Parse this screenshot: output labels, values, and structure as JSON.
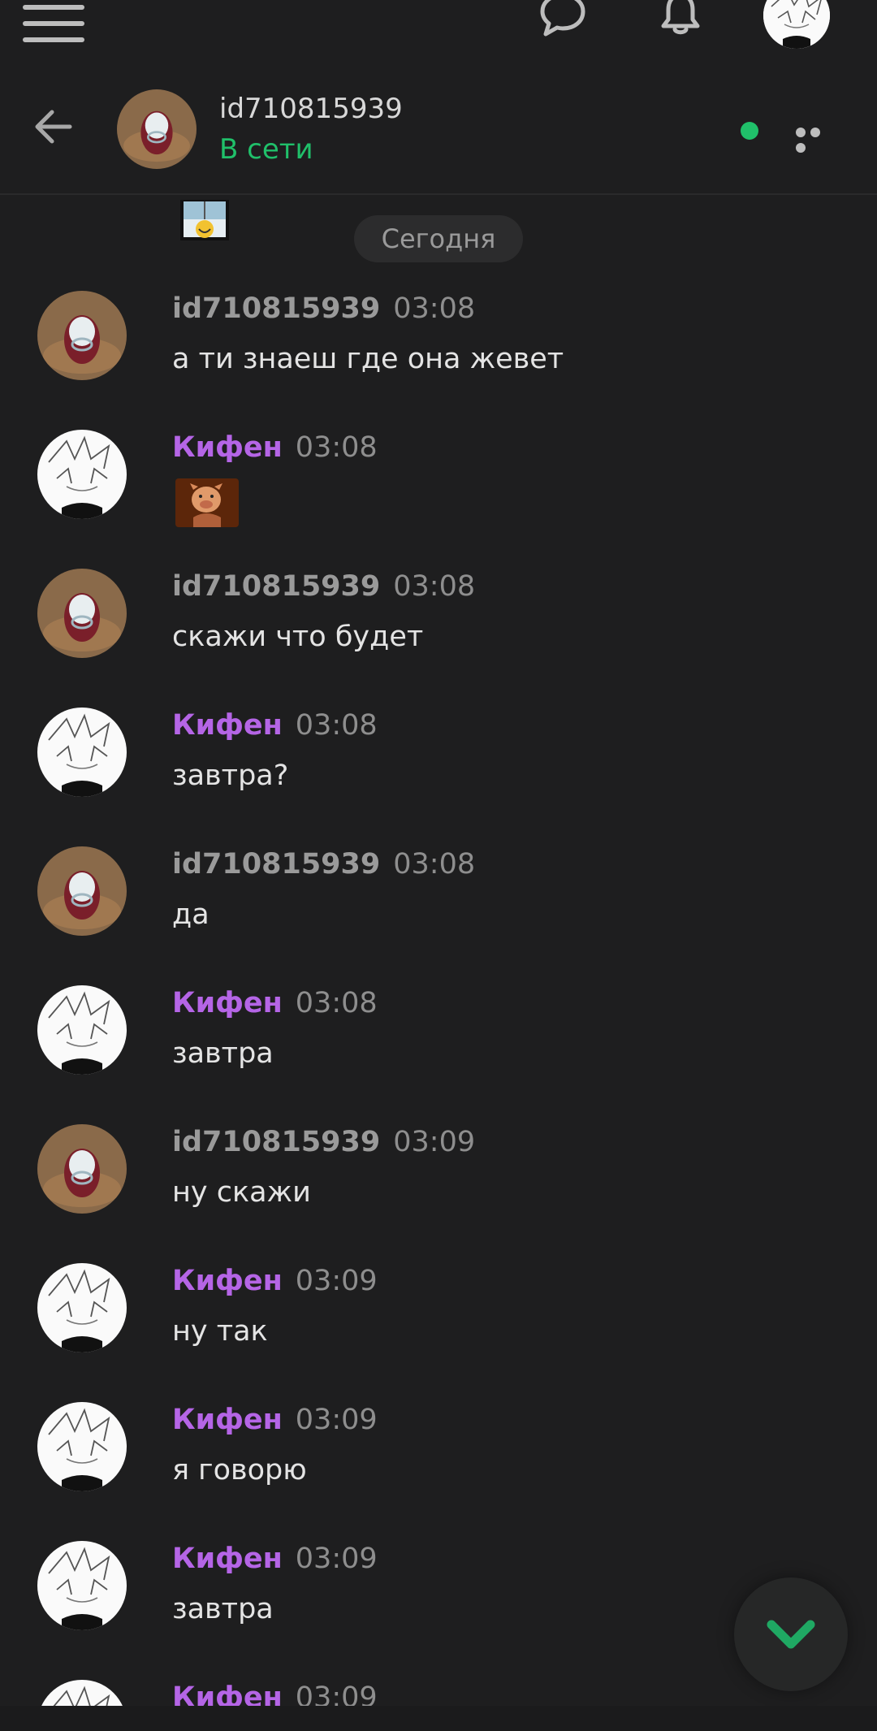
{
  "header": {
    "contact_name": "id710815939",
    "status": "В сети"
  },
  "date_separator": "Сегодня",
  "colors": {
    "background": "#1e1e1f",
    "online_green": "#20c06a",
    "kifen_purple": "#b565e6",
    "other_author_gray": "#9a9a9a",
    "accent_chevron": "#1fa863"
  },
  "messages": [
    {
      "author": "id710815939",
      "time": "03:08",
      "text": "а ти знаеш где она жевет"
    },
    {
      "author": "Кифен",
      "time": "03:08",
      "sticker": "pig-sticker"
    },
    {
      "author": "id710815939",
      "time": "03:08",
      "text": "скажи что будет"
    },
    {
      "author": "Кифен",
      "time": "03:08",
      "text": "завтра?"
    },
    {
      "author": "id710815939",
      "time": "03:08",
      "text": "да"
    },
    {
      "author": "Кифен",
      "time": "03:08",
      "text": "завтра"
    },
    {
      "author": "id710815939",
      "time": "03:09",
      "text": "ну скажи"
    },
    {
      "author": "Кифен",
      "time": "03:09",
      "text": "ну так"
    },
    {
      "author": "Кифен",
      "time": "03:09",
      "text": "я говорю"
    },
    {
      "author": "Кифен",
      "time": "03:09",
      "text": "завтра"
    },
    {
      "author": "Кифен",
      "time": "03:09",
      "text": ""
    }
  ],
  "icons": {
    "menu": "hamburger-menu-icon",
    "chats": "chat-bubble-icon",
    "notifications": "bell-icon",
    "back": "arrow-left-icon",
    "more": "more-dots-icon",
    "scroll_down": "chevron-down-icon"
  }
}
